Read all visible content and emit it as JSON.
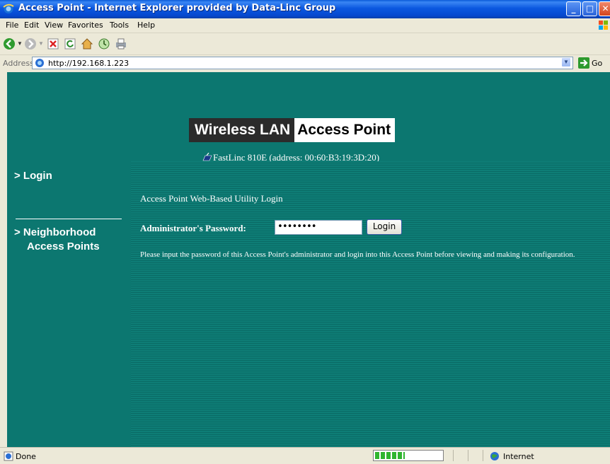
{
  "window": {
    "title": "Access Point - Internet Explorer provided by Data-Linc Group",
    "controls": [
      "minimize",
      "maximize",
      "close"
    ]
  },
  "menu": {
    "items": [
      "File",
      "Edit",
      "View",
      "Favorites",
      "Tools",
      "Help"
    ]
  },
  "toolbar": {
    "icons": [
      "back-icon",
      "forward-icon",
      "stop-icon",
      "refresh-icon",
      "home-icon",
      "history-icon",
      "print-icon"
    ]
  },
  "address": {
    "label": "Address",
    "url": "http://192.168.1.223",
    "go_label": "Go"
  },
  "page": {
    "brand_part1": "Wireless LAN",
    "brand_part2": "Access Point",
    "device_info": "FastLinc 810E (address: 00:60:B3:19:3D:20)",
    "nav": {
      "login": "> Login",
      "neighborhood_line1": "> Neighborhood",
      "neighborhood_line2": "Access Points"
    },
    "main": {
      "intro": "Access Point Web-Based Utility Login",
      "password_label": "Administrator's Password:",
      "password_value": "••••••••",
      "login_button": "Login",
      "help_text": "Please input the password of this Access Point's administrator and login into this Access Point before viewing and making its configuration."
    },
    "colors": {
      "background": "#0c7770",
      "text": "#ffffff"
    }
  },
  "status": {
    "text": "Done",
    "progress_fraction": 0.45,
    "zone": "Internet"
  }
}
